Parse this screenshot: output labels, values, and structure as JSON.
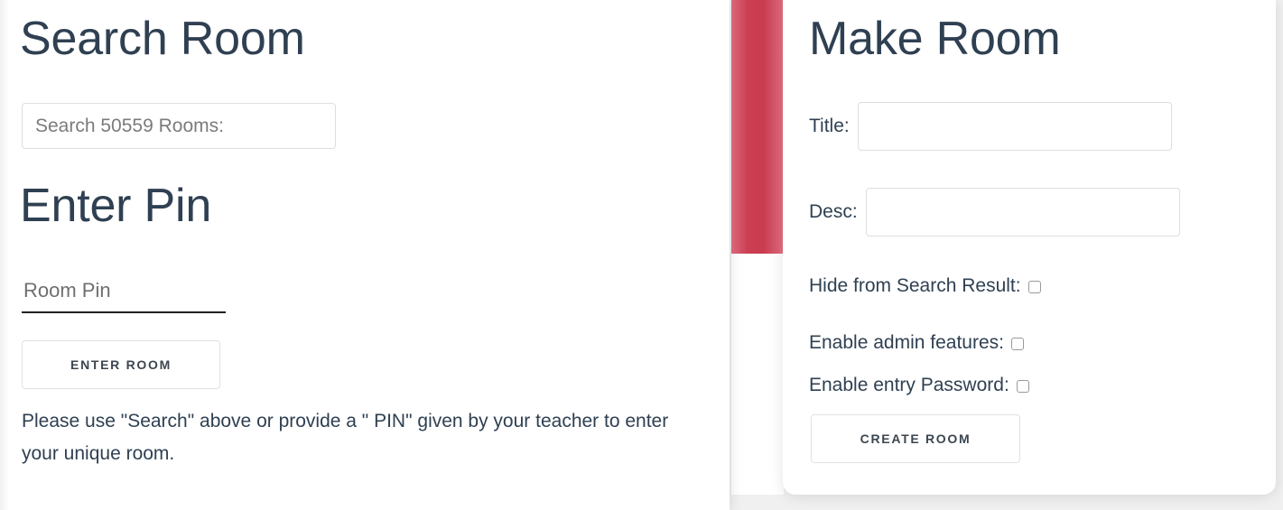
{
  "search_panel": {
    "title": "Search Room",
    "search_input": {
      "placeholder": "Search 50559 Rooms:",
      "value": ""
    },
    "pin_title": "Enter Pin",
    "pin_input": {
      "placeholder": "Room Pin",
      "value": ""
    },
    "enter_room_button": "ENTER ROOM",
    "help_text": "Please use \"Search\" above or provide a \" PIN\" given by your teacher to enter your unique room."
  },
  "make_panel": {
    "title": "Make Room",
    "title_field": {
      "label": "Title:",
      "placeholder": "",
      "value": ""
    },
    "desc_field": {
      "label": "Desc:",
      "placeholder": "",
      "value": ""
    },
    "options": [
      {
        "label": "Hide from Search Result:",
        "checked": false
      },
      {
        "label": "Enable admin features:",
        "checked": false
      },
      {
        "label": "Enable entry Password:",
        "checked": false
      }
    ],
    "create_room_button": "CREATE ROOM"
  },
  "theme": {
    "accent_color": "#cc3e52",
    "heading_color": "#2f4052",
    "card_background": "#ffffff",
    "page_background": "#f0f0f1"
  }
}
